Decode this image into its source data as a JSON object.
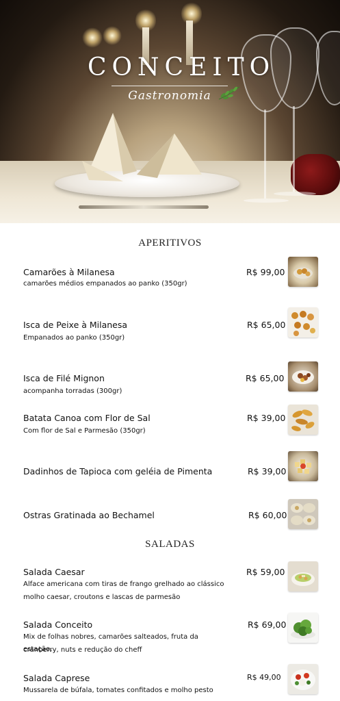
{
  "header": {
    "brand_title": "CONCEITO",
    "brand_subtitle": "Gastronomia"
  },
  "sections": [
    {
      "title": "APERITIVOS",
      "items": [
        {
          "name": "Camarões à Milanesa",
          "description": "camarões médios empanados ao panko (350gr)",
          "price": "R$ 99,00",
          "photo": "fried-shrimp"
        },
        {
          "name": "Isca de Peixe à Milanesa",
          "description": "Empanados ao panko (350gr)",
          "price": "R$ 65,00",
          "photo": "fried-fish"
        },
        {
          "name": "Isca de Filé Mignon",
          "description": "acompanha torradas (300gr)",
          "price": "R$ 65,00",
          "photo": "beef-strips"
        },
        {
          "name": "Batata Canoa com Flor de Sal",
          "description": "Com flor de Sal e Parmesão (350gr)",
          "price": "R$ 39,00",
          "photo": "potato-wedges"
        },
        {
          "name": "Dadinhos de Tapioca com geléia de Pimenta",
          "description": "",
          "price": "R$ 39,00",
          "photo": "tapioca-cubes"
        },
        {
          "name": "Ostras Gratinada ao Bechamel",
          "description": "",
          "price": "R$ 60,00",
          "photo": "gratin-oysters"
        }
      ]
    },
    {
      "title": "SALADAS",
      "items": [
        {
          "name": "Salada Caesar",
          "description_lines": [
            "Alface americana com tiras de frango grelhado ao clássico",
            "molho caesar, croutons e lascas de parmesão"
          ],
          "price": "R$ 59,00",
          "photo": "caesar-salad"
        },
        {
          "name": "Salada Conceito",
          "description_lines": [
            "Mix de folhas nobres, camarões salteados, fruta da estação,",
            "cranberry, nuts e redução do cheff"
          ],
          "price": "R$ 69,00",
          "photo": "green-salad"
        },
        {
          "name": "Salada Caprese",
          "description_lines": [
            "Mussarela de búfala, tomates confitados e molho pesto"
          ],
          "price": "R$ 49,00",
          "photo": "caprese-salad"
        }
      ]
    }
  ],
  "colors": {
    "text": "#111111",
    "hero_dark": "#1a130c",
    "hero_light": "#efe7d6",
    "rose": "#7a1515"
  }
}
